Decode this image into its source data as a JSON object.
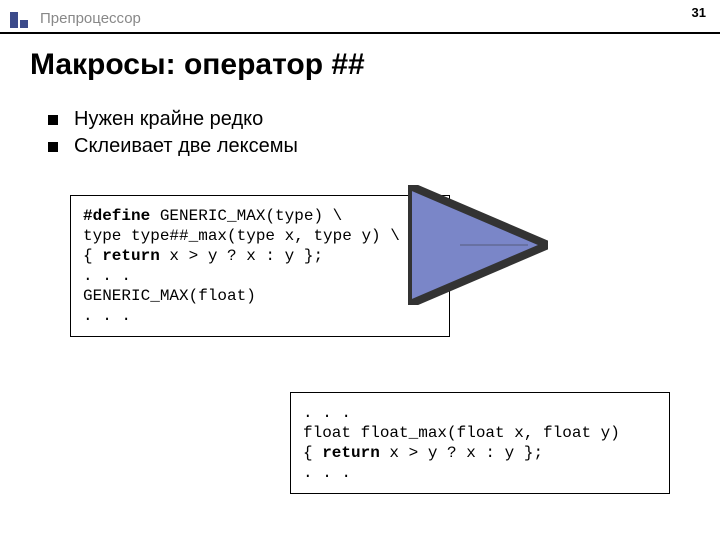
{
  "header": {
    "label": "Препроцессор",
    "page_number": "31"
  },
  "title": "Макросы: оператор ##",
  "bullets": [
    "Нужен крайне редко",
    "Склеивает две лексемы"
  ],
  "code1": {
    "l1a": "#define",
    "l1b": " GENERIC_MAX(type) \\",
    "l2": "type type##_max(type x, type y) \\",
    "l3a": "{ ",
    "l3b": "return",
    "l3c": " x > y ? x : y };",
    "l4": ". . .",
    "l5": "GENERIC_MAX(float)",
    "l6": ". . ."
  },
  "code2": {
    "l1": ". . .",
    "l2": "float float_max(float x, float y)",
    "l3a": "{ ",
    "l3b": "return",
    "l3c": " x > y ? x : y };",
    "l4": ". . ."
  },
  "icons": {
    "header_bullet": "square-bullet-icon",
    "list_bullet": "square-bullet-icon",
    "arrow": "arrow-icon"
  }
}
